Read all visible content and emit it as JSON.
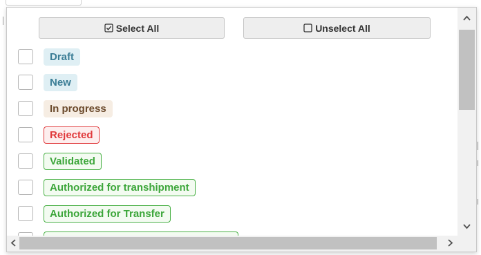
{
  "buttons": {
    "select_all": {
      "label": "Select All",
      "icon": "checked-square-icon"
    },
    "unselect_all": {
      "label": "Unselect All",
      "icon": "empty-square-icon"
    }
  },
  "status_options": [
    {
      "label": "Draft",
      "style": "info",
      "checked": false
    },
    {
      "label": "New",
      "style": "info",
      "checked": false
    },
    {
      "label": "In progress",
      "style": "progress",
      "checked": false
    },
    {
      "label": "Rejected",
      "style": "danger",
      "checked": false
    },
    {
      "label": "Validated",
      "style": "success",
      "checked": false
    },
    {
      "label": "Authorized for transhipment",
      "style": "success",
      "checked": false
    },
    {
      "label": "Authorized for Transfer",
      "style": "success",
      "checked": false
    },
    {
      "label": "",
      "style": "success",
      "checked": false
    }
  ],
  "colors": {
    "info_bg": "#dfeff4",
    "info_text": "#3a7d95",
    "progress_bg": "#f6ede3",
    "progress_text": "#6b4a2c",
    "danger_border": "#e0393b",
    "success_border": "#48b045",
    "scrollbar_thumb": "#c1c1c1"
  },
  "scrollbars": {
    "vertical_position": 0,
    "horizontal_position": 0
  }
}
